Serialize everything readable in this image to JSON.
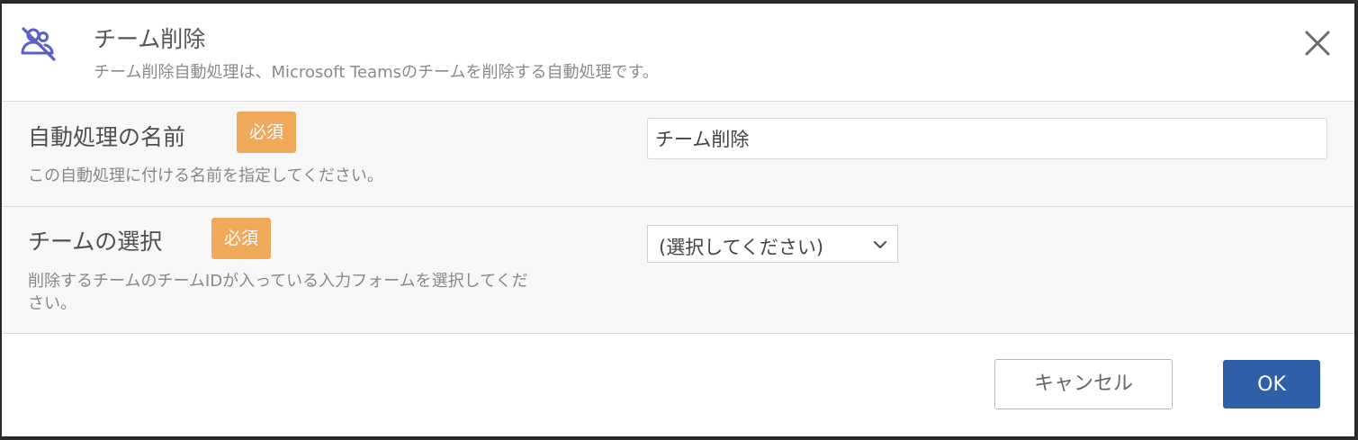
{
  "dialog": {
    "icon": "team-remove-icon",
    "title": "チーム削除",
    "subtitle": "チーム削除自動処理は、Microsoft Teamsのチームを削除する自動処理です。",
    "close_icon": "close-icon"
  },
  "fields": {
    "name": {
      "label": "自動処理の名前",
      "badge": "必須",
      "help": "この自動処理に付ける名前を指定してください。",
      "value": "チーム削除"
    },
    "team_select": {
      "label": "チームの選択",
      "badge": "必須",
      "help_line1": "削除するチームのチームIDが入っている入力フォームを選択してくだ",
      "help_line2": "さい。",
      "selected": "(選択してください)",
      "chevron_icon": "chevron-down-icon"
    }
  },
  "footer": {
    "cancel_label": "キャンセル",
    "ok_label": "OK"
  },
  "colors": {
    "accent_icon": "#5b5fc7",
    "badge": "#f0a95b",
    "primary_button": "#2f5fa8",
    "row_background": "#f7f7f7"
  }
}
